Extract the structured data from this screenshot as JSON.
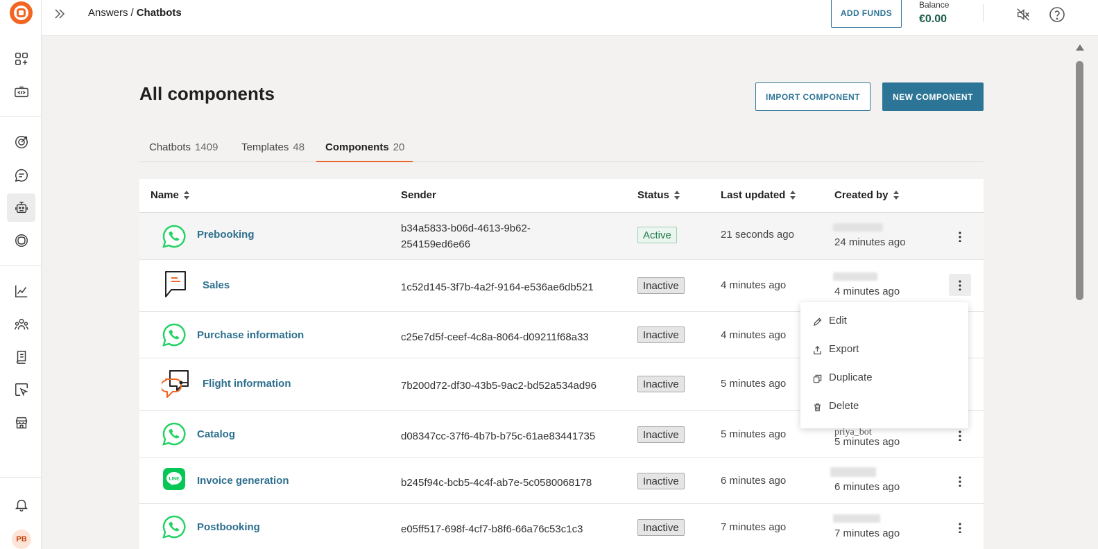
{
  "header": {
    "breadcrumb_parent": "Answers",
    "breadcrumb_separator": "/",
    "breadcrumb_current": "Chatbots",
    "add_funds_label": "ADD FUNDS",
    "balance_label": "Balance",
    "balance_value": "€0.00"
  },
  "sidebar": {
    "avatar_initials": "PB",
    "items": [
      "apps-icon",
      "code-icon",
      "target-icon",
      "chat-icon",
      "robot-icon",
      "ai-icon",
      "analytics-icon",
      "people-icon",
      "book-icon",
      "select-icon",
      "store-icon",
      "bell-icon"
    ]
  },
  "page": {
    "title": "All components",
    "import_label": "IMPORT COMPONENT",
    "new_label": "NEW COMPONENT"
  },
  "tabs": [
    {
      "label": "Chatbots",
      "count": "1409",
      "active": false
    },
    {
      "label": "Templates",
      "count": "48",
      "active": false
    },
    {
      "label": "Components",
      "count": "20",
      "active": true
    }
  ],
  "table": {
    "columns": [
      "Name",
      "Sender",
      "Status",
      "Last updated",
      "Created by"
    ],
    "rows": [
      {
        "name": "Prebooking",
        "icon": "whatsapp-icon",
        "sender": "b34a5833-b06d-4613-9b62-254159ed6e66",
        "status": "Active",
        "updated": "21 seconds ago",
        "created": "24 minutes ago"
      },
      {
        "name": "Sales",
        "icon": "sms-chat-icon",
        "sender": "1c52d145-3f7b-4a2f-9164-e536ae6db521",
        "status": "Inactive",
        "updated": "4 minutes ago",
        "created": "4 minutes ago"
      },
      {
        "name": "Purchase information",
        "icon": "whatsapp-icon",
        "sender": "c25e7d5f-ceef-4c8a-8064-d09211f68a33",
        "status": "Inactive",
        "updated": "4 minutes ago",
        "created": ""
      },
      {
        "name": "Flight information",
        "icon": "live-chat-icon",
        "sender": "7b200d72-df30-43b5-9ac2-bd52a534ad96",
        "status": "Inactive",
        "updated": "5 minutes ago",
        "created": ""
      },
      {
        "name": "Catalog",
        "icon": "whatsapp-icon",
        "sender": "d08347cc-37f6-4b7b-b75c-61ae83441735",
        "status": "Inactive",
        "updated": "5 minutes ago",
        "created": "5 minutes ago"
      },
      {
        "name": "Invoice generation",
        "icon": "line-icon",
        "sender": "b245f94c-bcb5-4c4f-ab7e-5c0580068178",
        "status": "Inactive",
        "updated": "6 minutes ago",
        "created": "6 minutes ago"
      },
      {
        "name": "Postbooking",
        "icon": "whatsapp-icon",
        "sender": "e05ff517-698f-4cf7-b8f6-66a76c53c1c3",
        "status": "Inactive",
        "updated": "7 minutes ago",
        "created": "7 minutes ago"
      }
    ]
  },
  "partial_creator": "priya_bot",
  "context_menu": {
    "items": [
      {
        "label": "Edit",
        "icon": "pencil-icon"
      },
      {
        "label": "Export",
        "icon": "export-icon"
      },
      {
        "label": "Duplicate",
        "icon": "duplicate-icon"
      },
      {
        "label": "Delete",
        "icon": "trash-icon"
      }
    ]
  },
  "colors": {
    "brand": "#f26522",
    "accent": "#2d7596",
    "active_tab": "#e8692a",
    "whatsapp": "#25d366",
    "line": "#06c755"
  }
}
